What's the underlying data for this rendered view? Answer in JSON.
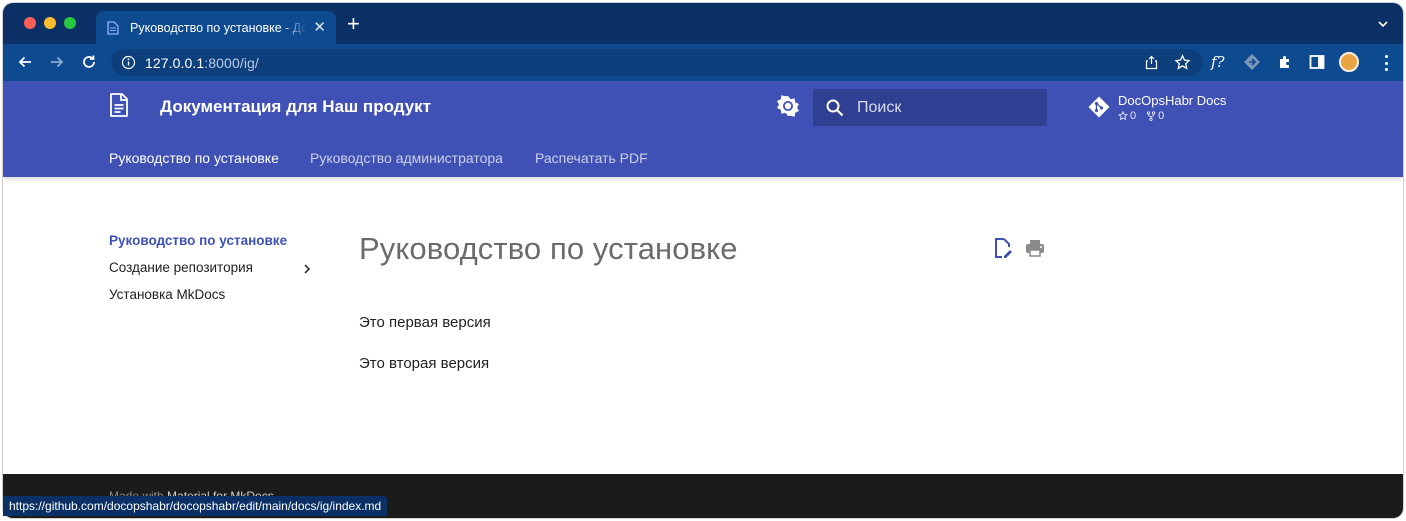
{
  "browser": {
    "tab_title": "Руководство по установке - Документация для Наш продукт",
    "new_tab_label": "+",
    "url_host": "127.0.0.1",
    "url_rest": ":8000/ig/",
    "extension_label": "f?",
    "status_url": "https://github.com/docopshabr/docopshabr/edit/main/docs/ig/index.md"
  },
  "header": {
    "site_title": "Документация для Наш продукт",
    "search_placeholder": "Поиск",
    "repo_name": "DocOpsHabr Docs",
    "stars": "0",
    "forks": "0"
  },
  "tabs": [
    {
      "label": "Руководство по установке",
      "active": true
    },
    {
      "label": "Руководство администратора",
      "active": false
    },
    {
      "label": "Распечатать PDF",
      "active": false
    }
  ],
  "nav": {
    "title": "Руководство по установке",
    "items": [
      {
        "label": "Создание репозитория",
        "has_children": true
      },
      {
        "label": "Установка MkDocs",
        "has_children": false
      }
    ]
  },
  "content": {
    "heading": "Руководство по установке",
    "paragraphs": [
      "Это первая версия",
      "Это вторая версия"
    ]
  },
  "footer": {
    "made_with_prefix": "Made with",
    "made_with_link": "Material for MkDocs"
  },
  "colors": {
    "primary": "#3f51b5",
    "browser_frame": "#0b3066",
    "browser_toolbar": "#0e4a8f",
    "footer": "#1b1b1b"
  }
}
